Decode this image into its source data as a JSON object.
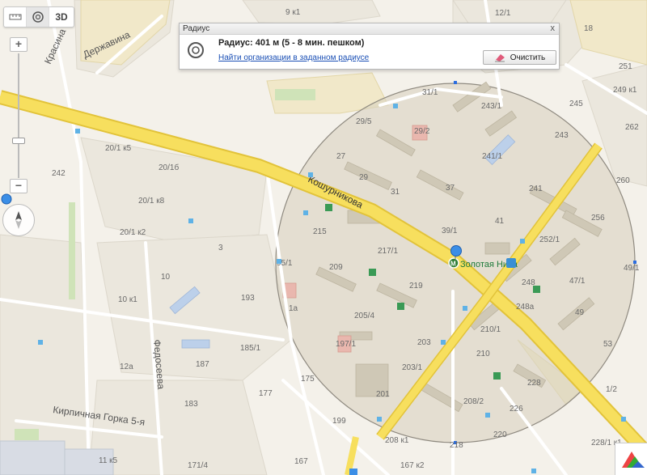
{
  "panel": {
    "header": "Радиус",
    "close_label": "x",
    "title": "Радиус: 401 м (5 - 8 мин. пешком)",
    "link": "Найти организации в заданном радиусе",
    "clear_label": "Очистить"
  },
  "toolbar": {
    "threed_label": "3D"
  },
  "zoom": {
    "plus": "+",
    "minus": "−"
  },
  "streets": {
    "kosh": "Кошурникова",
    "krasina": "Красина",
    "derzhavina": "Державина",
    "fedoseeva": "Федосеева",
    "kirpichnaya": "Кирпичная Горка 5-я"
  },
  "place_label": "Золотая Нива",
  "metro_letter": "М",
  "buildings": [
    "9 к1",
    "12/1",
    "18",
    "251",
    "249 к1",
    "245",
    "262",
    "31/1",
    "243/1",
    "29/5",
    "29/2",
    "27",
    "243",
    "241/1",
    "20/1 к5",
    "20/1б",
    "29",
    "241",
    "37",
    "31",
    "242",
    "260",
    "20/1 к8",
    "256",
    "20/1 к2",
    "215",
    "39/1",
    "41",
    "252/1",
    "3",
    "95/1",
    "217/1",
    "209",
    "248",
    "47/1",
    "49/1",
    "10",
    "219",
    "193",
    "1а",
    "248а",
    "49",
    "10 к1",
    "205/4",
    "210/1",
    "203",
    "197/1",
    "185/1",
    "53",
    "187",
    "210",
    "12а",
    "203/1",
    "175",
    "228",
    "177",
    "201",
    "208/2",
    "1/2",
    "183",
    "226",
    "199",
    "220",
    "228/1 к1",
    "208 к1",
    "218",
    "11 к5",
    "171/4",
    "167",
    "167 к2"
  ]
}
